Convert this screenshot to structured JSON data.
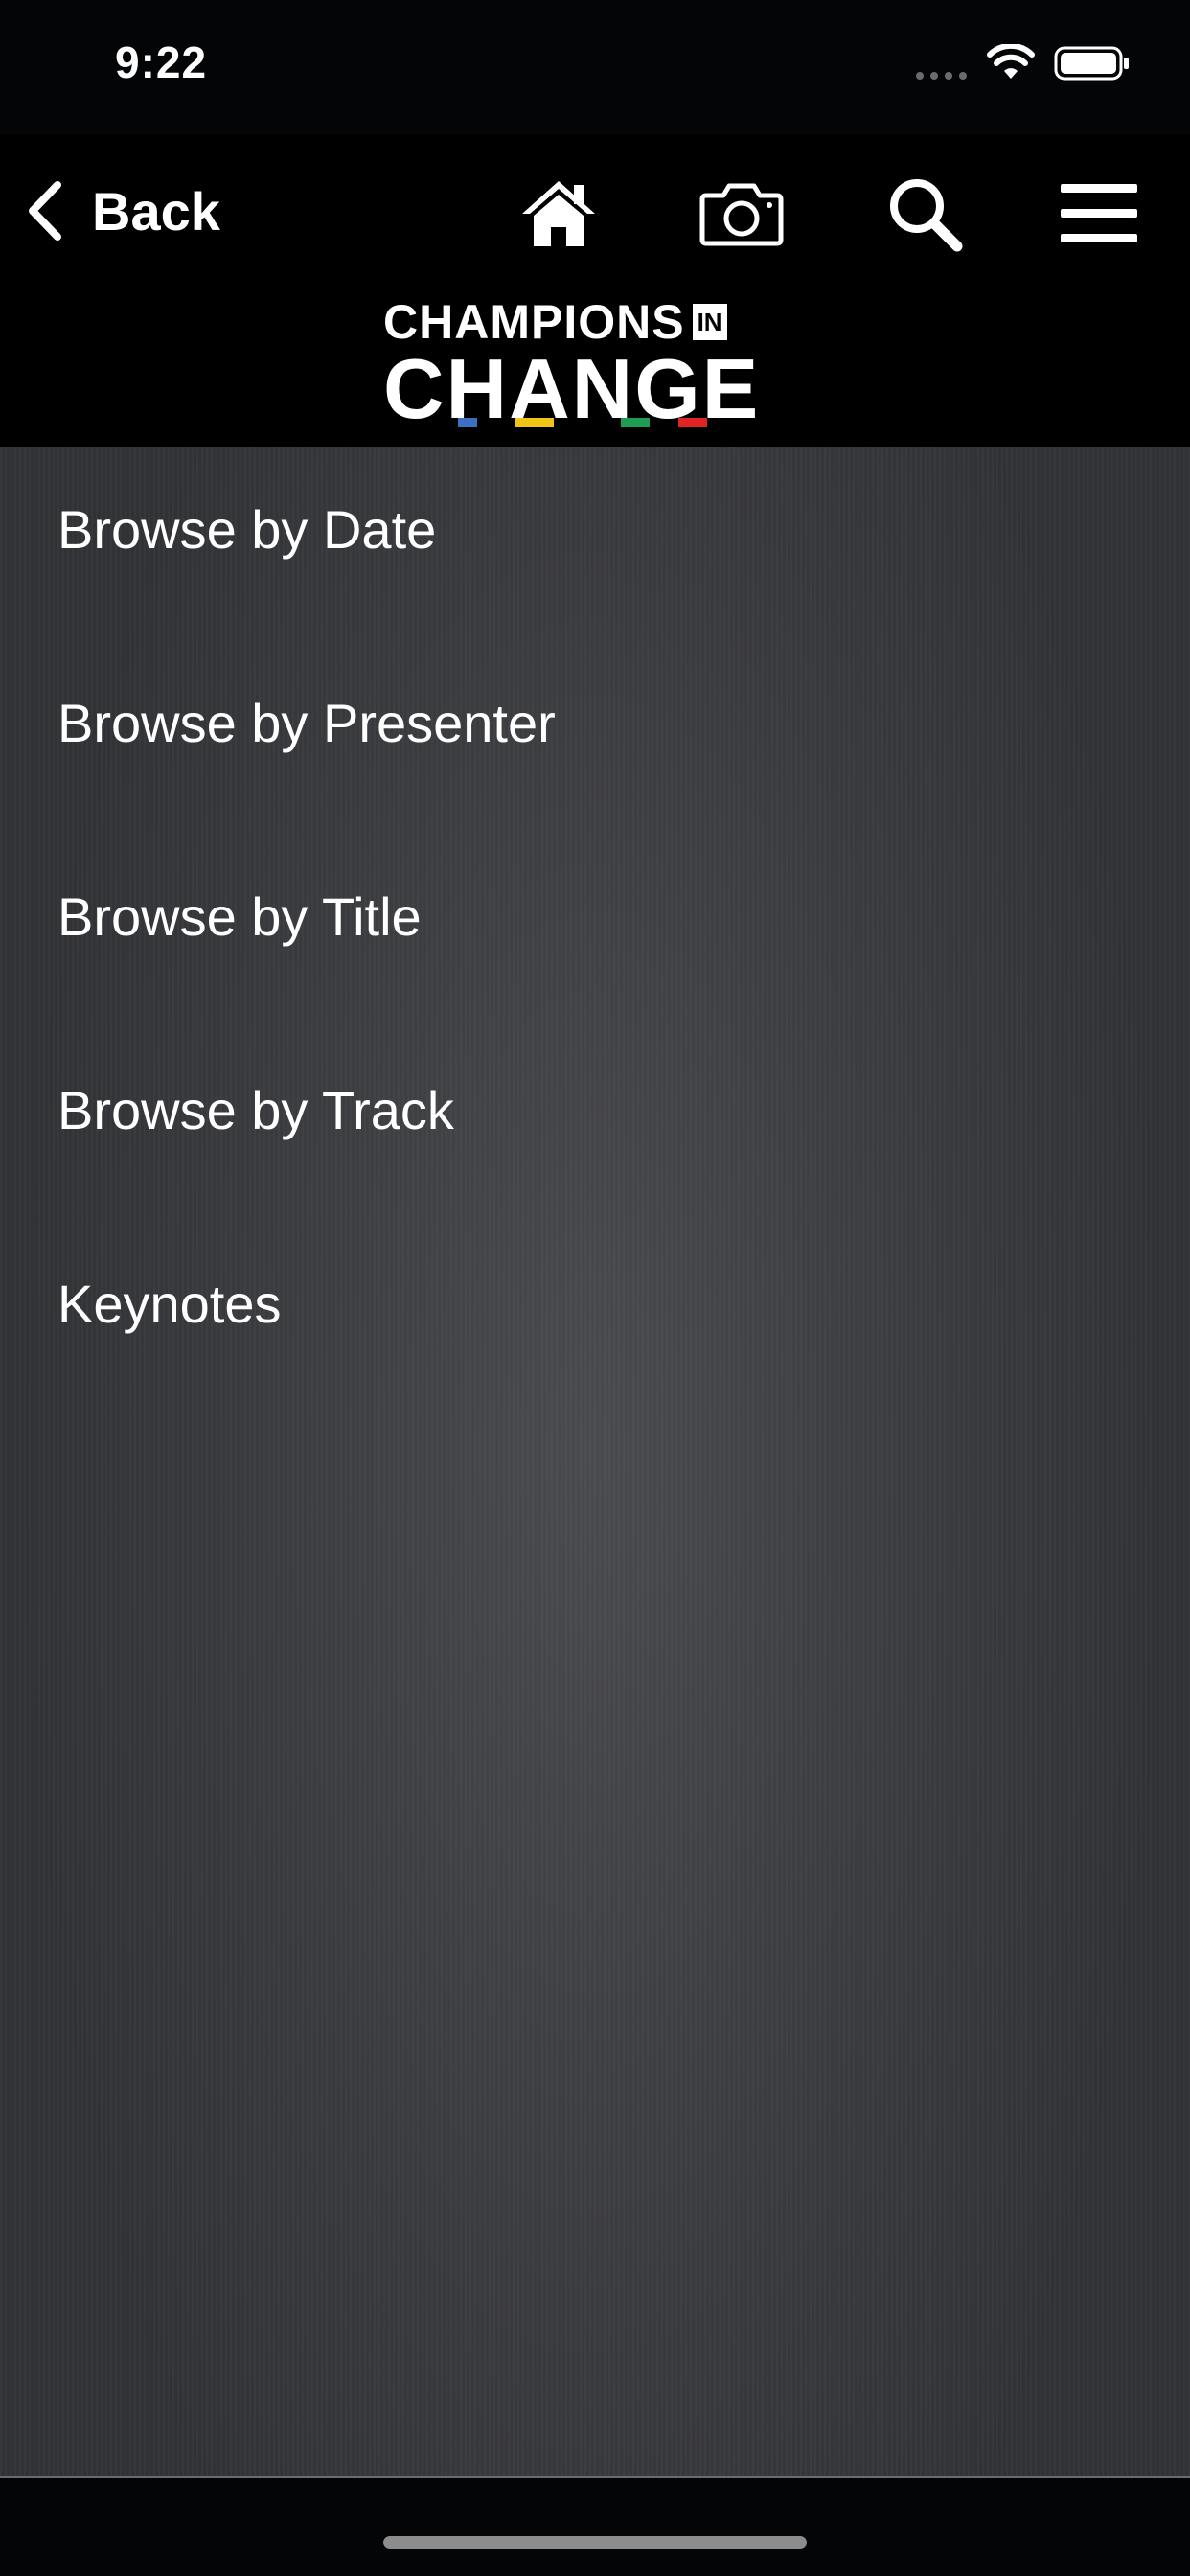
{
  "status_bar": {
    "time": "9:22"
  },
  "nav": {
    "back_label": "Back",
    "icons": [
      "home-icon",
      "camera-icon",
      "search-icon",
      "menu-icon"
    ]
  },
  "logo": {
    "line1": "CHAMPIONS",
    "badge": "IN",
    "line2": "CHANGE",
    "stripe_colors": [
      "#3f6fc3",
      "#f0c419",
      "#1f9d55",
      "#e02424"
    ]
  },
  "menu": {
    "items": [
      {
        "label": "Browse by Date"
      },
      {
        "label": "Browse by Presenter"
      },
      {
        "label": "Browse by Title"
      },
      {
        "label": "Browse by Track"
      },
      {
        "label": "Keynotes"
      }
    ]
  }
}
